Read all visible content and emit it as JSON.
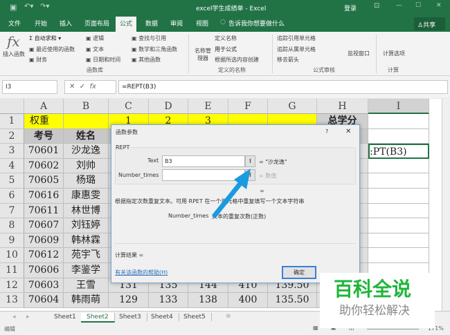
{
  "window": {
    "title": "excel学生成绩单 - Excel",
    "login": "登录"
  },
  "tabs": [
    "文件",
    "开始",
    "插入",
    "页面布局",
    "公式",
    "数据",
    "审阅",
    "视图"
  ],
  "tell_me": "告诉我你想要做什么",
  "share": "共享",
  "ribbon": {
    "insert_fn": "插入函数",
    "autosum": "自动求和",
    "recent": "最近使用的函数",
    "finance": "财务",
    "logic": "逻辑",
    "text": "文本",
    "datetime": "日期和时间",
    "lookup": "查找与引用",
    "math": "数学和三角函数",
    "other": "其他函数",
    "group_lib": "函数库",
    "name_mgr": "名称管理器",
    "define_name": "定义名称",
    "use_formula": "用于公式",
    "create_sel": "根据所选内容创建",
    "group_names": "定义的名称",
    "trace_prec": "追踪引用单元格",
    "trace_dep": "追踪从属单元格",
    "remove_arrows": "移去箭头",
    "group_audit": "公式审核",
    "watch": "监视窗口",
    "calc_opts": "计算选项",
    "group_calc": "计算"
  },
  "formula_bar": {
    "name_box": "I3",
    "formula": "=REPT(B3)"
  },
  "columns": [
    "A",
    "B",
    "C",
    "D",
    "E",
    "F",
    "G",
    "H",
    "I"
  ],
  "rows": [
    [
      "权重",
      "",
      "1",
      "2",
      "3",
      "",
      "",
      "总学分",
      ""
    ],
    [
      "考号",
      "姓名",
      "",
      "",
      "",
      "",
      "",
      "",
      ""
    ],
    [
      "70601",
      "沙龙逸",
      "",
      "",
      "",
      "",
      "",
      "",
      ":PT(B3)"
    ],
    [
      "70602",
      "刘帅",
      "",
      "",
      "",
      "",
      "",
      "",
      ""
    ],
    [
      "70605",
      "杨璐",
      "",
      "",
      "",
      "",
      "",
      "",
      ""
    ],
    [
      "70616",
      "康惠雯",
      "",
      "",
      "",
      "",
      "",
      "",
      ""
    ],
    [
      "70611",
      "林世博",
      "",
      "",
      "",
      "",
      "",
      "",
      ""
    ],
    [
      "70607",
      "刘钰婷",
      "",
      "",
      "",
      "",
      "",
      "",
      ""
    ],
    [
      "70609",
      "韩林霖",
      "",
      "",
      "",
      "",
      "",
      "",
      ""
    ],
    [
      "70612",
      "苑宇飞",
      "",
      "",
      "",
      "",
      "",
      "",
      ""
    ],
    [
      "70606",
      "李鉴学",
      "",
      "",
      "",
      "",
      "",
      "",
      ""
    ],
    [
      "70603",
      "王雪",
      "131",
      "135",
      "144",
      "410",
      "139.50",
      "",
      ""
    ],
    [
      "70604",
      "韩雨萌",
      "129",
      "133",
      "138",
      "400",
      "135.50",
      "",
      ""
    ]
  ],
  "dialog": {
    "title": "函数参数",
    "help": "?",
    "fn": "REPT",
    "arg1_label": "Text",
    "arg1_value": "B3",
    "arg1_result": "= \"沙龙逸\"",
    "arg2_label": "Number_times",
    "arg2_value": "",
    "arg2_result": "= 数值",
    "eq": "=",
    "desc": "根据指定次数重复文本。可用 RPET 在一个单元格中重复填写一个文本字符串",
    "arg_desc_name": "Number_times",
    "arg_desc": "文本的重复次数(正数)",
    "calc_result": "计算结果 =",
    "help_link": "有关该函数的帮助(H)",
    "ok": "确定"
  },
  "sheets": [
    "Sheet1",
    "Sheet2",
    "Sheet3",
    "Sheet4",
    "Sheet5"
  ],
  "status": {
    "mode": "编辑",
    "zoom": "171%"
  },
  "watermark": {
    "title": "百科全说",
    "subtitle": "助你轻松解决"
  }
}
